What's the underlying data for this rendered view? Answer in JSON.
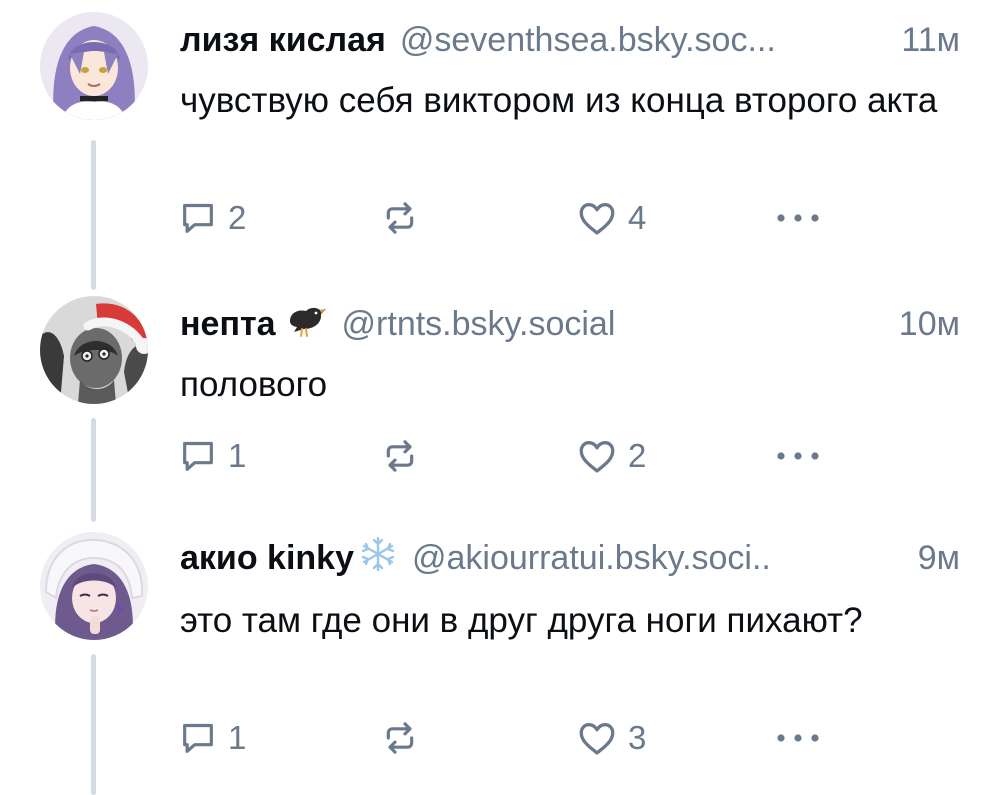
{
  "posts": [
    {
      "author_name": "лизя кислая",
      "author_handle": "@seventhsea.bsky.soc...",
      "time": "11м",
      "text": "чувствую себя виктором из конца второго акта",
      "replies": "2",
      "likes": "4",
      "avatar_icon": "anime-girl-purple-hair-avatar"
    },
    {
      "author_name": "нептa",
      "author_handle": "@rtnts.bsky.social",
      "time": "10м",
      "text": "полового",
      "replies": "1",
      "likes": "2",
      "name_emoji": "bird-emoji",
      "avatar_icon": "santa-hat-character-avatar"
    },
    {
      "author_name": "акио kinky",
      "author_handle": "@akiourratui.bsky.soci..",
      "time": "9м",
      "text": "это там где они в друг друга ноги пихают?",
      "replies": "1",
      "likes": "3",
      "name_emoji": "snowflake-emoji",
      "avatar_icon": "anime-girl-winter-hood-avatar"
    }
  ],
  "colors": {
    "text_primary": "#0b0f14",
    "text_secondary": "#6a7a8c",
    "thread_line": "#d4dbe2",
    "background": "#ffffff"
  }
}
